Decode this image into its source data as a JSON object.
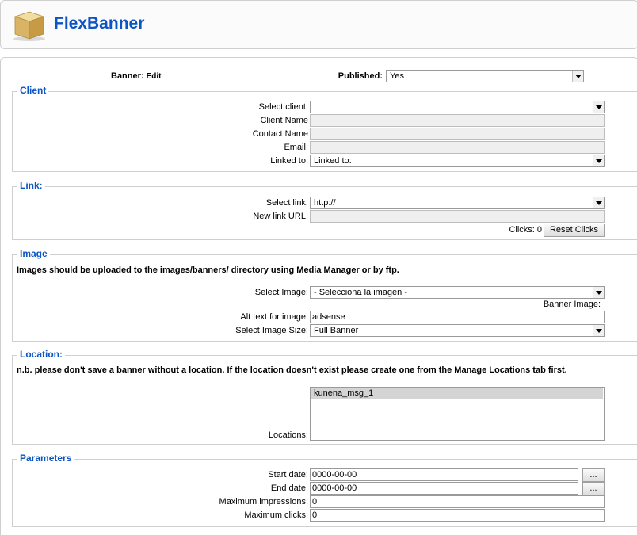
{
  "header": {
    "title": "FlexBanner",
    "logo_icon": "box-icon"
  },
  "top": {
    "banner_label": "Banner:",
    "banner_mode": "Edit",
    "published_label": "Published:",
    "published_value": "Yes"
  },
  "client": {
    "legend": "Client",
    "select_label": "Select client:",
    "select_value": "",
    "name_label": "Client Name",
    "contact_label": "Contact Name",
    "email_label": "Email:",
    "linked_label": "Linked to:",
    "linked_value": "Linked to:"
  },
  "link": {
    "legend": "Link:",
    "select_label": "Select link:",
    "select_value": "http://",
    "new_url_label": "New link URL:",
    "clicks_label": "Clicks: 0",
    "reset_label": "Reset Clicks"
  },
  "image": {
    "legend": "Image",
    "note": "Images should be uploaded to the images/banners/ directory using Media Manager or by ftp.",
    "select_label": "Select Image:",
    "select_value": "- Selecciona la imagen -",
    "banner_image_label": "Banner Image:",
    "alt_label": "Alt text for image:",
    "alt_value": "adsense",
    "size_label": "Select Image Size:",
    "size_value": "Full Banner"
  },
  "location": {
    "legend": "Location:",
    "note": "n.b. please don't save a banner without a location. If the location doesn't exist please create one from the Manage Locations tab first.",
    "locations_label": "Locations:",
    "options": [
      "kunena_msg_1"
    ]
  },
  "parameters": {
    "legend": "Parameters",
    "start_label": "Start date:",
    "start_value": "0000-00-00",
    "end_label": "End date:",
    "end_value": "0000-00-00",
    "picker_label": "...",
    "max_impr_label": "Maximum impressions:",
    "max_impr_value": "0",
    "max_clicks_label": "Maximum clicks:",
    "max_clicks_value": "0"
  }
}
